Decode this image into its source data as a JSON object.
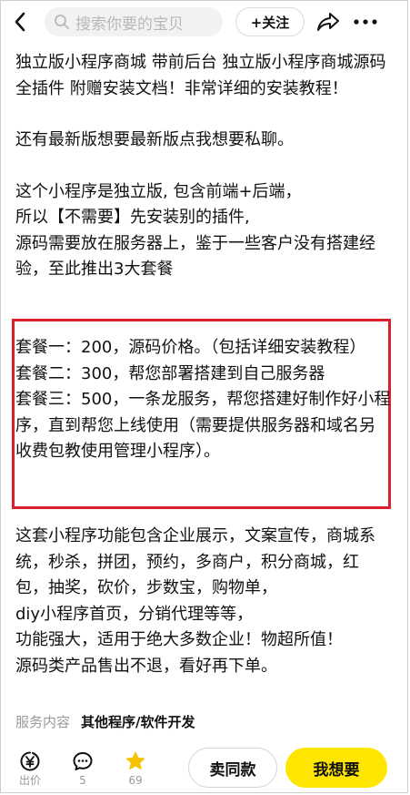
{
  "header": {
    "search_placeholder": "搜索你要的宝贝",
    "follow_label": "+关注"
  },
  "description": {
    "paragraphs_top": [
      "独立版小程序商城 带前后台 独立版小程序商城源码全插件 附赠安装文档！非常详细的安装教程！",
      "还有最新版想要最新版点我想要私聊。",
      "这个小程序是独立版, 包含前端+后端，\n所以【不需要】先安装别的插件,\n源码需要放在服务器上，鉴于一些客户没有搭建经验，至此推出3大套餐"
    ],
    "packages": [
      "套餐一：200，源码价格。（包括详细安装教程）",
      "套餐二：300，帮您部署搭建到自己服务器",
      "套餐三：500，一条龙服务，帮您搭建好制作好小程序，直到帮您上线使用（需要提供服务器和域名另收费包教使用管理小程序）。"
    ],
    "paragraph_bottom": "这套小程序功能包含企业展示，文案宣传，商城系统，秒杀，拼团，预约，多商户，积分商城，红包，抽奖，砍价，步数宝，购物单，\ndiy小程序首页，分销代理等等，\n功能强大，适用于绝大多数企业！物超所值！\n源码类产品售出不退，看好再下单。"
  },
  "service": {
    "key": "服务内容",
    "value": "其他程序/软件开发"
  },
  "bottom_bar": {
    "price_label": "出价",
    "comment_count": "5",
    "favorite_count": "69",
    "sell_same_label": "卖同款",
    "want_label": "我想要"
  },
  "colors": {
    "highlight_border": "#d9202b",
    "want_button": "#ffe600",
    "favorite_star": "#f5c400"
  },
  "icons": {
    "back": "chevron-left-icon",
    "search": "search-icon",
    "share": "share-icon",
    "more": "more-icon",
    "price": "yen-icon",
    "comment": "comment-icon",
    "favorite": "star-icon"
  }
}
